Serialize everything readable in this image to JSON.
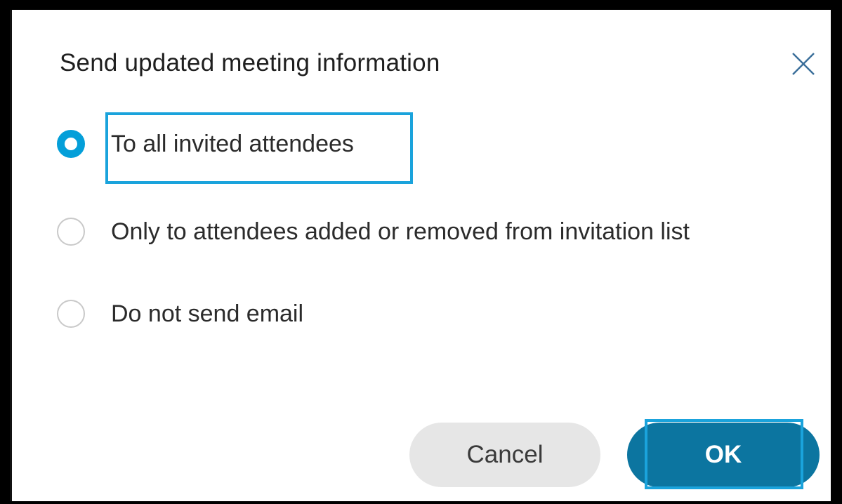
{
  "dialog": {
    "title": "Send updated meeting information",
    "close_icon": "close-icon",
    "options": [
      {
        "label": "To all invited attendees",
        "selected": true
      },
      {
        "label": "Only to attendees added or removed from invitation list",
        "selected": false
      },
      {
        "label": "Do not send email",
        "selected": false
      }
    ],
    "buttons": {
      "cancel_label": "Cancel",
      "ok_label": "OK"
    }
  },
  "colors": {
    "accent": "#049fd9",
    "primary_button": "#0c75a0",
    "secondary_button": "#e6e6e6",
    "highlight": "#1aa3dc"
  }
}
